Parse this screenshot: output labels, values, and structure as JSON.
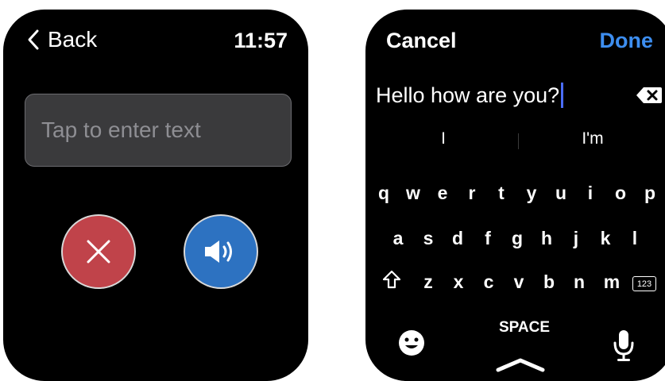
{
  "left_screen": {
    "back_label": "Back",
    "time": "11:57",
    "text_field_placeholder": "Tap to enter text",
    "cancel_icon": "close-icon",
    "speak_icon": "speaker-icon",
    "colors": {
      "cancel": "#c0434a",
      "speak": "#2d72c1"
    }
  },
  "right_screen": {
    "cancel_label": "Cancel",
    "done_label": "Done",
    "entered_text": "Hello how are you?",
    "suggestions": [
      "I",
      "",
      "I'm"
    ],
    "keyboard": {
      "row1": [
        "q",
        "w",
        "e",
        "r",
        "t",
        "y",
        "u",
        "i",
        "o",
        "p"
      ],
      "row2": [
        "a",
        "s",
        "d",
        "f",
        "g",
        "h",
        "j",
        "k",
        "l"
      ],
      "row3": [
        "z",
        "x",
        "c",
        "v",
        "b",
        "n",
        "m"
      ],
      "numbers_key": "123",
      "space_label": "SPACE"
    },
    "colors": {
      "done": "#3d8ef0",
      "cursor": "#4a6cf7"
    }
  }
}
